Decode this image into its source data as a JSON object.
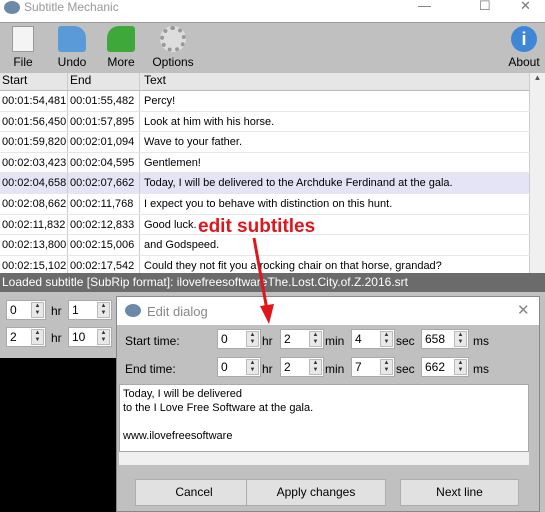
{
  "window": {
    "title": "Subtitle Mechanic",
    "minimize": "—",
    "maximize": "☐",
    "close": "✕"
  },
  "toolbar": [
    {
      "label": "File",
      "icon": "file-icon"
    },
    {
      "label": "Undo",
      "icon": "undo-icon"
    },
    {
      "label": "More",
      "icon": "more-icon"
    },
    {
      "label": "Options",
      "icon": "gear-icon"
    },
    {
      "label": "About",
      "icon": "info-icon"
    }
  ],
  "grid": {
    "columns": [
      "Start",
      "End",
      "Text"
    ],
    "rows": [
      [
        "00:01:54,481",
        "00:01:55,482",
        "Percy!"
      ],
      [
        "00:01:56,450",
        "00:01:57,895",
        "Look at him with his horse."
      ],
      [
        "00:01:59,820",
        "00:02:01,094",
        "Wave to your father."
      ],
      [
        "00:02:03,423",
        "00:02:04,595",
        "Gentlemen!"
      ],
      [
        "00:02:04,658",
        "00:02:07,662",
        "Today, I will be delivered to the Archduke Ferdinand at the gala."
      ],
      [
        "00:02:08,662",
        "00:02:11,768",
        "I expect you to behave with distinction on this hunt."
      ],
      [
        "00:02:11,832",
        "00:02:12,833",
        "Good luck."
      ],
      [
        "00:02:13,800",
        "00:02:15,006",
        "and Godspeed."
      ],
      [
        "00:02:15,102",
        "00:02:17,542",
        "Could they not fit you a rocking chair on that horse, grandad?"
      ]
    ],
    "selected_index": 4
  },
  "status": "Loaded subtitle [SubRip format]: ilovefreesoftwareThe.Lost.City.of.Z.2016.srt",
  "left_panel": {
    "row1": [
      "0",
      "1"
    ],
    "row2": [
      "2",
      "10"
    ],
    "hr": "hr"
  },
  "dialog": {
    "title": "Edit dialog",
    "close": "✕",
    "start_label": "Start time:",
    "end_label": "End time:",
    "start": [
      "0",
      "2",
      "4",
      "658"
    ],
    "end": [
      "0",
      "2",
      "7",
      "662"
    ],
    "units": [
      "hr",
      "min",
      "sec",
      "ms"
    ],
    "text": "Today, I will be delivered\nto the I Love Free Software at the gala.\n\nwww.ilovefreesoftware",
    "cancel": "Cancel",
    "apply": "Apply changes",
    "next": "Next line"
  },
  "annotation": {
    "text": "edit subtitles",
    "color": "#e0161b"
  }
}
